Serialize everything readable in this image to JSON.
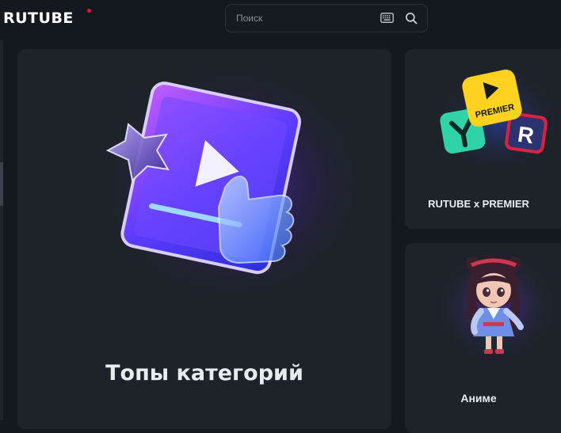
{
  "header": {
    "logo_text": "RUTUBE",
    "search": {
      "placeholder": "Поиск"
    },
    "keyboard_icon": "keyboard-icon",
    "search_icon": "search-icon"
  },
  "cards": {
    "main": {
      "title": "Топы категорий",
      "art": "tablet-play-thumbs-up-illustration"
    },
    "premier": {
      "title": "RUTUBE x PREMIER",
      "art": "premier-logo-cubes-illustration",
      "badge_text": "PREMIER"
    },
    "anime": {
      "title": "Аниме",
      "art": "anime-girl-illustration"
    }
  },
  "colors": {
    "background": "#14191f",
    "card": "#1e232a",
    "accent_red": "#ed143b",
    "text": "#e9ecef",
    "muted": "#8a9099"
  }
}
